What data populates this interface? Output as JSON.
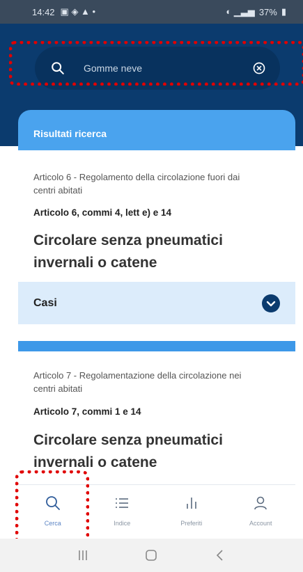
{
  "status_bar": {
    "time": "14:42",
    "battery": "37%"
  },
  "search": {
    "placeholder": "Gomme neve"
  },
  "results": {
    "title": "Risultati ricerca",
    "items": [
      {
        "reference": "Articolo 6 - Regolamento della circolazione fuori dai centri abitati",
        "subref": "Articolo 6, commi 4, lett e) e 14",
        "title": "Circolare senza pneumatici invernali o catene",
        "cases_label": "Casi"
      },
      {
        "reference": "Articolo 7 - Regolamentazione della circolazione nei centri abitati",
        "subref": "Articolo 7, commi 1 e 14",
        "title": "Circolare senza pneumatici invernali o catene"
      }
    ]
  },
  "bottom_nav": {
    "items": [
      {
        "label": "Cerca",
        "icon": "search-icon",
        "active": true
      },
      {
        "label": "Indice",
        "icon": "list-icon"
      },
      {
        "label": "Preferiti",
        "icon": "chart-icon"
      },
      {
        "label": "Account",
        "icon": "user-icon"
      }
    ]
  },
  "colors": {
    "header": "#0b3b6e",
    "accent": "#4aa3ee",
    "case_row": "#dcecfb",
    "highlight": "#e00000"
  }
}
